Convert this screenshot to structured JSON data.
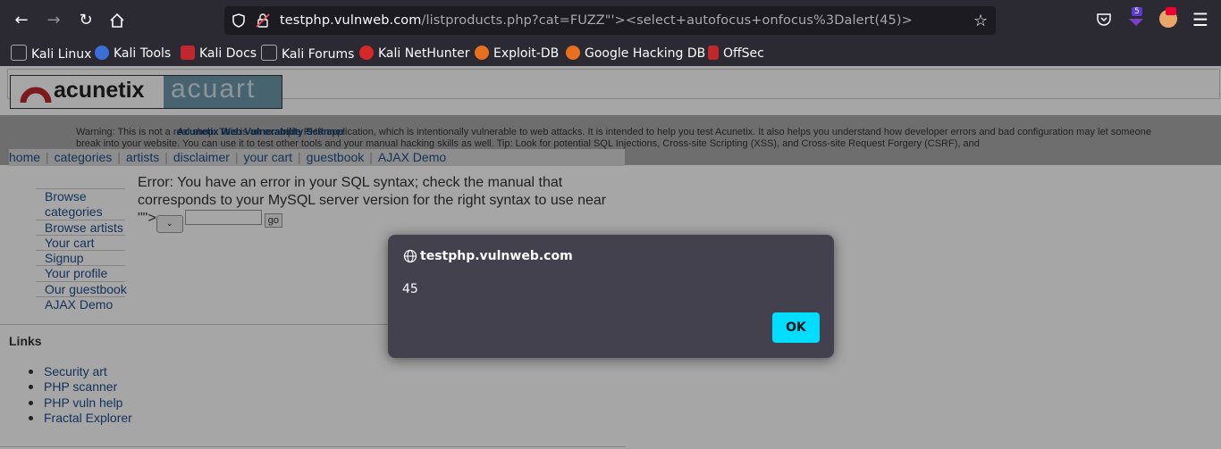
{
  "browser": {
    "url_host": "testphp.vulnweb.com",
    "url_rest": "/listproducts.php?cat=FUZZ\"'><select+autofocus+onfocus%3Dalert(45)>",
    "extension_badge": "5",
    "bookmarks": [
      "Kali Linux",
      "Kali Tools",
      "Kali Docs",
      "Kali Forums",
      "Kali NetHunter",
      "Exploit-DB",
      "Google Hacking DB",
      "OffSec"
    ]
  },
  "page": {
    "logo_left": "acunetix",
    "logo_right": "acuart",
    "warning_title": "Acunetix Web Vulnerability Scanner",
    "warning_text": "Warning: This is not a real shop. This is an example PHP application, which is intentionally vulnerable to web attacks. It is intended to help you test Acunetix. It also helps you understand how developer errors and bad configuration may let someone break into your website. You can use it to test other tools and your manual hacking skills as well. Tip: Look for potential SQL Injections, Cross-site Scripting (XSS), and Cross-site Request Forgery (CSRF), and",
    "nav": [
      "home",
      "categories",
      "artists",
      "disclaimer",
      "your cart",
      "guestbook",
      "AJAX Demo"
    ],
    "menu": [
      "Browse categories",
      "Browse artists",
      "Your cart",
      "Signup",
      "Your profile",
      "Our guestbook",
      "AJAX Demo"
    ],
    "error_text": "Error: You have an error in your SQL syntax; check the manual that corresponds to your MySQL server version for the right syntax to use near",
    "error_tail": "\"\">",
    "go_label": "go",
    "links_title": "Links",
    "links": [
      "Security art",
      "PHP scanner",
      "PHP vuln help",
      "Fractal Explorer"
    ]
  },
  "dialog": {
    "origin": "testphp.vulnweb.com",
    "message": "45",
    "ok_label": "OK"
  },
  "colors": {
    "chrome_bg": "#2b2a33",
    "dialog_bg": "#42414d",
    "ok_button": "#00ddff",
    "link": "#1f4e8a"
  }
}
